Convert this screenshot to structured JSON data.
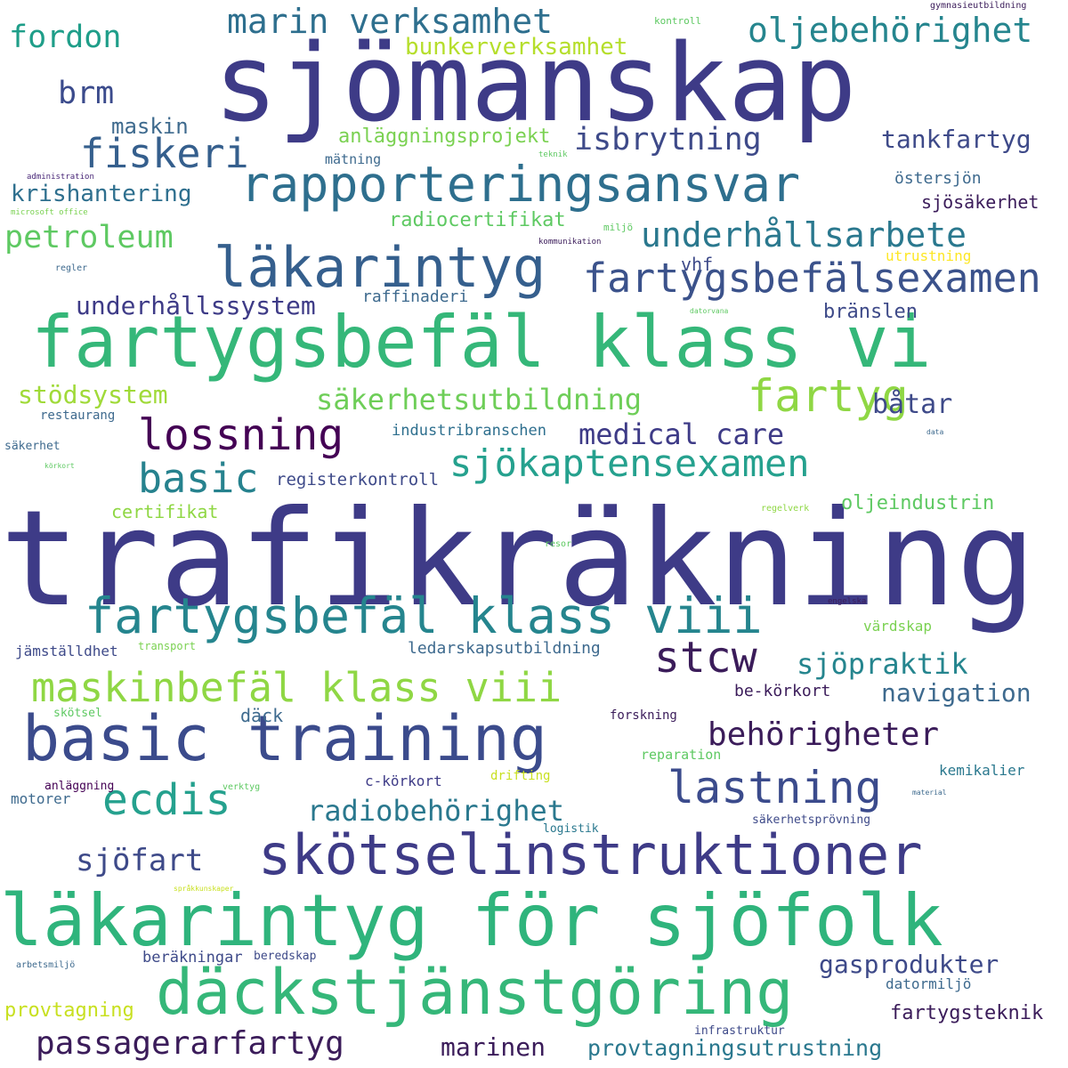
{
  "palette": {
    "background": "#ffffff",
    "indigo": "#3e3b87",
    "navy": "#3b4b8c",
    "slate": "#355f8d",
    "blue": "#2e6f8e",
    "teal": "#25858e",
    "sea": "#1f9e89",
    "green": "#35b779",
    "lime": "#6ece58",
    "lightlime": "#8fd744",
    "yellow": "#c8e020",
    "purple": "#440154",
    "plum": "#482677"
  },
  "words": [
    {
      "text": "trafikräkning",
      "color": "#3e3b87"
    },
    {
      "text": "sjömanskap",
      "color": "#3e3b87"
    },
    {
      "text": "fartygsbefäl klass vi",
      "color": "#35b779"
    },
    {
      "text": "läkarintyg för sjöfolk",
      "color": "#2fb47c"
    },
    {
      "text": "däckstjänstgöring",
      "color": "#35b779"
    },
    {
      "text": "basic training",
      "color": "#3b4b8c"
    },
    {
      "text": "skötselinstruktioner",
      "color": "#3e3b87"
    },
    {
      "text": "läkarintyg",
      "color": "#355f8d"
    },
    {
      "text": "rapporteringsansvar",
      "color": "#2e6f8e"
    },
    {
      "text": "fartygsbefäl klass viii",
      "color": "#25858e"
    },
    {
      "text": "maskinbefäl klass viii",
      "color": "#8fd744"
    },
    {
      "text": "fartygsbefälsexamen",
      "color": "#3b528b"
    },
    {
      "text": "sjökaptensexamen",
      "color": "#25a18e"
    },
    {
      "text": "lossning",
      "color": "#440154"
    },
    {
      "text": "fartyg",
      "color": "#8fd744"
    },
    {
      "text": "stcw",
      "color": "#3b1c5a"
    },
    {
      "text": "lastning",
      "color": "#3b4b8c"
    },
    {
      "text": "ecdis",
      "color": "#25a18e"
    },
    {
      "text": "basic",
      "color": "#26828e"
    },
    {
      "text": "fiskeri",
      "color": "#355f8d"
    },
    {
      "text": "marin verksamhet",
      "color": "#2e6f8e"
    },
    {
      "text": "oljebehörighet",
      "color": "#25858e"
    },
    {
      "text": "fordon",
      "color": "#1f9e89"
    },
    {
      "text": "bunkerverksamhet",
      "color": "#b5de2b"
    },
    {
      "text": "brm",
      "color": "#3b4b8c"
    },
    {
      "text": "maskin",
      "color": "#3e6a8e"
    },
    {
      "text": "anläggningsprojekt",
      "color": "#7ad151"
    },
    {
      "text": "isbrytning",
      "color": "#3e4a89"
    },
    {
      "text": "tankfartyg",
      "color": "#3e4a89"
    },
    {
      "text": "krishantering",
      "color": "#2e6f8e"
    },
    {
      "text": "petroleum",
      "color": "#5ec962"
    },
    {
      "text": "underhållsarbete",
      "color": "#2a788e"
    },
    {
      "text": "radiocertifikat",
      "color": "#5ec962"
    },
    {
      "text": "sjösäkerhet",
      "color": "#3b1c5a"
    },
    {
      "text": "östersjön",
      "color": "#3e6a8e"
    },
    {
      "text": "vhf",
      "color": "#3e4a89"
    },
    {
      "text": "utrustning",
      "color": "#fde725"
    },
    {
      "text": "underhållssystem",
      "color": "#3e3b87"
    },
    {
      "text": "raffinaderi",
      "color": "#3e6a8e"
    },
    {
      "text": "bränslen",
      "color": "#3e4a89"
    },
    {
      "text": "stödsystem",
      "color": "#a0da39"
    },
    {
      "text": "säkerhetsutbildning",
      "color": "#6ece58"
    },
    {
      "text": "båtar",
      "color": "#3e4a89"
    },
    {
      "text": "medical care",
      "color": "#3e3b87"
    },
    {
      "text": "industribranschen",
      "color": "#2e6f8e"
    },
    {
      "text": "restaurang",
      "color": "#3e6a8e"
    },
    {
      "text": "säkerhet",
      "color": "#3e6a8e"
    },
    {
      "text": "registerkontroll",
      "color": "#3e4a89"
    },
    {
      "text": "certifikat",
      "color": "#8fd744"
    },
    {
      "text": "oljeindustrin",
      "color": "#5ec962"
    },
    {
      "text": "sjöpraktik",
      "color": "#25858e"
    },
    {
      "text": "navigation",
      "color": "#3e6a8e"
    },
    {
      "text": "behörigheter",
      "color": "#3b1c5a"
    },
    {
      "text": "jämställdhet",
      "color": "#3e4a89"
    },
    {
      "text": "ledarskapsutbildning",
      "color": "#3e6a8e"
    },
    {
      "text": "värdskap",
      "color": "#7ad151"
    },
    {
      "text": "be-körkort",
      "color": "#3b1c5a"
    },
    {
      "text": "däck",
      "color": "#3e6a8e"
    },
    {
      "text": "skötsel",
      "color": "#5ec962"
    },
    {
      "text": "forskning",
      "color": "#3b1c5a"
    },
    {
      "text": "reparation",
      "color": "#5ec962"
    },
    {
      "text": "kemikalier",
      "color": "#2a788e"
    },
    {
      "text": "radiobehörighet",
      "color": "#2a788e"
    },
    {
      "text": "anläggning",
      "color": "#440154"
    },
    {
      "text": "motorer",
      "color": "#3e6a8e"
    },
    {
      "text": "c-körkort",
      "color": "#3e3b87"
    },
    {
      "text": "drifting",
      "color": "#c8e020"
    },
    {
      "text": "säkerhetsprövning",
      "color": "#3e4a89"
    },
    {
      "text": "logistik",
      "color": "#2a788e"
    },
    {
      "text": "sjöfart",
      "color": "#3e4a89"
    },
    {
      "text": "gasprodukter",
      "color": "#3e4a89"
    },
    {
      "text": "datormiljö",
      "color": "#3e6a8e"
    },
    {
      "text": "fartygsteknik",
      "color": "#3b1c5a"
    },
    {
      "text": "provtagning",
      "color": "#c8e020"
    },
    {
      "text": "beräkningar",
      "color": "#3e4a89"
    },
    {
      "text": "beredskap",
      "color": "#3e4a89"
    },
    {
      "text": "passagerarfartyg",
      "color": "#3b1c5a"
    },
    {
      "text": "marinen",
      "color": "#3b1c5a"
    },
    {
      "text": "provtagningsutrustning",
      "color": "#2a788e"
    },
    {
      "text": "infrastruktur",
      "color": "#3e4a89"
    },
    {
      "text": "kontroll",
      "color": "#5ec962"
    },
    {
      "text": "gymnasieutbildning",
      "color": "#3b1c5a"
    },
    {
      "text": "mätning",
      "color": "#3e6a8e"
    },
    {
      "text": "teknik",
      "color": "#5ec962"
    },
    {
      "text": "administration",
      "color": "#482677"
    },
    {
      "text": "microsoft office",
      "color": "#7ad151"
    },
    {
      "text": "miljö",
      "color": "#5ec962"
    },
    {
      "text": "kommunikation",
      "color": "#3b1c5a"
    },
    {
      "text": "regler",
      "color": "#3e6a8e"
    },
    {
      "text": "datorvana",
      "color": "#5ec962"
    },
    {
      "text": "data",
      "color": "#3e6a8e"
    },
    {
      "text": "körkort",
      "color": "#5ec962"
    },
    {
      "text": "regelverk",
      "color": "#8fd744"
    },
    {
      "text": "resor",
      "color": "#5ec962"
    },
    {
      "text": "engelska",
      "color": "#3b1c5a"
    },
    {
      "text": "transport",
      "color": "#7ad151"
    },
    {
      "text": "verktyg",
      "color": "#5ec962"
    },
    {
      "text": "material",
      "color": "#3e6a8e"
    },
    {
      "text": "språkkunskaper",
      "color": "#c8e020"
    },
    {
      "text": "arbetsmiljö",
      "color": "#3e6a8e"
    }
  ]
}
